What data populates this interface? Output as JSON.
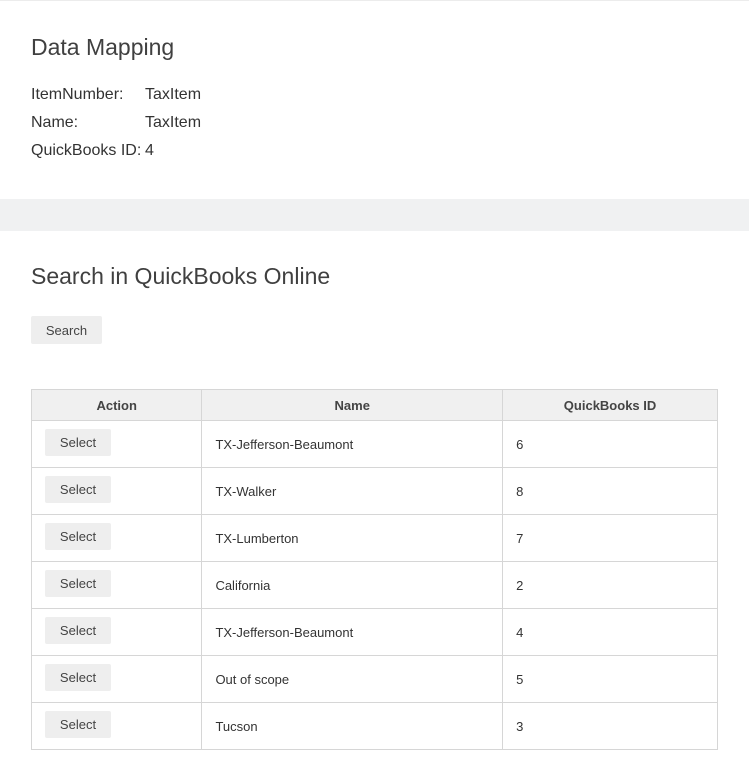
{
  "mapping": {
    "title": "Data Mapping",
    "fields": [
      {
        "label": "ItemNumber:",
        "value": "TaxItem"
      },
      {
        "label": "Name:",
        "value": "TaxItem"
      },
      {
        "label": "QuickBooks ID:",
        "value": "4"
      }
    ]
  },
  "search": {
    "title": "Search in QuickBooks Online",
    "button_label": "Search"
  },
  "results": {
    "columns": [
      "Action",
      "Name",
      "QuickBooks ID"
    ],
    "select_label": "Select",
    "rows": [
      {
        "name": "TX-Jefferson-Beaumont",
        "id": "6"
      },
      {
        "name": "TX-Walker",
        "id": "8"
      },
      {
        "name": "TX-Lumberton",
        "id": "7"
      },
      {
        "name": "California",
        "id": "2"
      },
      {
        "name": "TX-Jefferson-Beaumont",
        "id": "4"
      },
      {
        "name": "Out of scope",
        "id": "5"
      },
      {
        "name": "Tucson",
        "id": "3"
      }
    ]
  }
}
